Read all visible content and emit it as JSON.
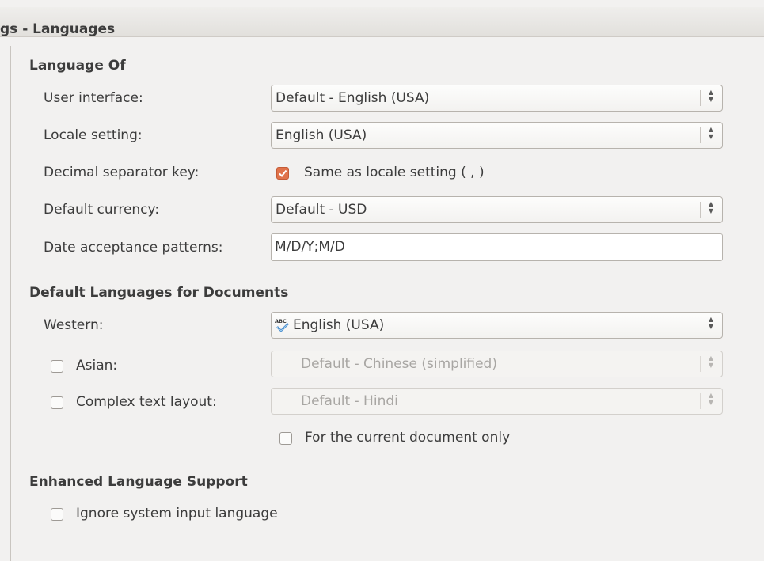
{
  "window": {
    "title": "gs - Languages"
  },
  "sections": {
    "language_of": "Language Of",
    "default_languages": "Default Languages for Documents",
    "enhanced": "Enhanced Language Support"
  },
  "language_of": {
    "user_interface": {
      "label": "User interface:",
      "value": "Default - English (USA)"
    },
    "locale_setting": {
      "label": "Locale setting:",
      "value": "English (USA)"
    },
    "decimal_separator": {
      "label": "Decimal separator key:",
      "checkbox_label": "Same as locale setting ( , )",
      "checked": true
    },
    "default_currency": {
      "label": "Default currency:",
      "value": "Default - USD"
    },
    "date_patterns": {
      "label": "Date acceptance patterns:",
      "value": "M/D/Y;M/D"
    }
  },
  "default_languages": {
    "western": {
      "label": "Western:",
      "value": "English (USA)",
      "icon": "spellcheck-abc-icon"
    },
    "asian": {
      "label": "Asian:",
      "value": "Default - Chinese (simplified)",
      "checked": false
    },
    "ctl": {
      "label": "Complex text layout:",
      "value": "Default - Hindi",
      "checked": false
    },
    "current_doc_only": {
      "label": "For the current document only",
      "checked": false
    }
  },
  "enhanced": {
    "ignore_system_input": {
      "label": "Ignore system input language",
      "checked": false
    }
  },
  "colors": {
    "accent": "#e0724a",
    "background": "#f2f1f0"
  }
}
